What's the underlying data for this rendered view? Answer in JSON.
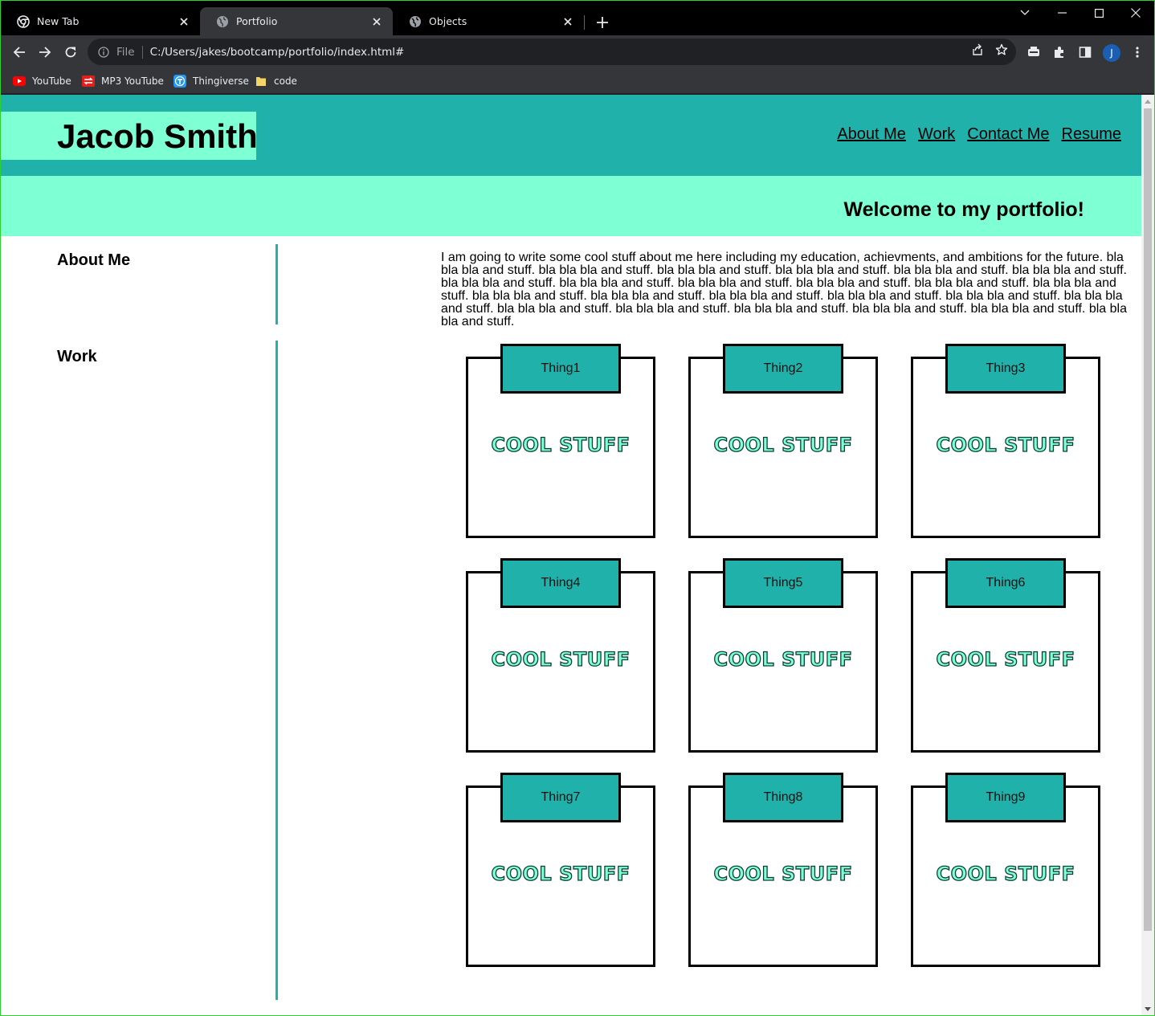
{
  "browser": {
    "tabs": [
      {
        "title": "New Tab",
        "active": false
      },
      {
        "title": "Portfolio",
        "active": true
      },
      {
        "title": "Objects",
        "active": false
      }
    ],
    "omnibox": {
      "scheme_label": "File",
      "url": "C:/Users/jakes/bootcamp/portfolio/index.html#"
    },
    "bookmarks": [
      {
        "label": "YouTube",
        "icon": "youtube-icon"
      },
      {
        "label": "MP3 YouTube",
        "icon": "mp3-youtube-icon"
      },
      {
        "label": "Thingiverse",
        "icon": "thingiverse-icon"
      },
      {
        "label": "code",
        "icon": "folder-icon"
      }
    ],
    "profile_initial": "J",
    "colors": {
      "accent_border": "#2fd12f",
      "profile": "#1a5fb4"
    }
  },
  "site": {
    "name": "Jacob Smith",
    "nav": [
      "About Me",
      "Work",
      "Contact Me",
      "Resume"
    ],
    "welcome": "Welcome to my portfolio!",
    "about": {
      "title": "About Me",
      "text": "I am going to write some cool stuff about me here including my education, achievments, and ambitions for the future. bla bla bla and stuff. bla bla bla and stuff. bla bla bla and stuff. bla bla bla and stuff. bla bla bla and stuff. bla bla bla and stuff. bla bla bla and stuff. bla bla bla and stuff. bla bla bla and stuff. bla bla bla and stuff. bla bla bla and stuff. bla bla bla and stuff. bla bla bla and stuff. bla bla bla and stuff. bla bla bla and stuff. bla bla bla and stuff. bla bla bla and stuff. bla bla bla and stuff. bla bla bla and stuff. bla bla bla and stuff. bla bla bla and stuff. bla bla bla and stuff. bla bla bla and stuff. bla bla bla and stuff."
    },
    "work": {
      "title": "Work",
      "items": [
        {
          "label": "Thing1",
          "caption": "COOL STUFF"
        },
        {
          "label": "Thing2",
          "caption": "COOL STUFF"
        },
        {
          "label": "Thing3",
          "caption": "COOL STUFF"
        },
        {
          "label": "Thing4",
          "caption": "COOL STUFF"
        },
        {
          "label": "Thing5",
          "caption": "COOL STUFF"
        },
        {
          "label": "Thing6",
          "caption": "COOL STUFF"
        },
        {
          "label": "Thing7",
          "caption": "COOL STUFF"
        },
        {
          "label": "Thing8",
          "caption": "COOL STUFF"
        },
        {
          "label": "Thing9",
          "caption": "COOL STUFF"
        }
      ]
    },
    "colors": {
      "primary": "#20b2aa",
      "secondary": "#7fffd4"
    }
  }
}
